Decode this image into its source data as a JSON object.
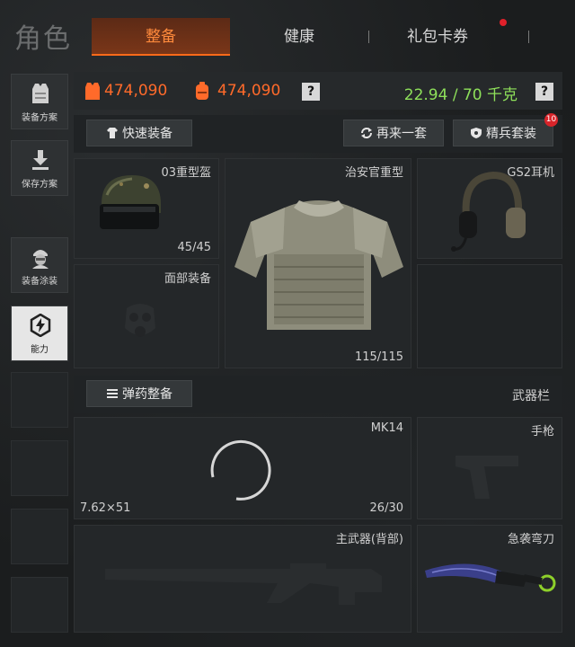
{
  "page_title": "角色",
  "tabs": [
    {
      "label": "整备",
      "active": true
    },
    {
      "label": "健康",
      "active": false
    },
    {
      "label": "礼包卡券",
      "active": false
    }
  ],
  "sidebar": [
    {
      "label": "装备方案",
      "icon": "vest-plan-icon"
    },
    {
      "label": "保存方案",
      "icon": "download-icon"
    },
    {
      "label": "装备涂装",
      "icon": "soldier-icon"
    },
    {
      "label": "能力",
      "icon": "lightning-icon",
      "active": true
    }
  ],
  "resources": {
    "vest_value": "474,090",
    "backpack_value": "474,090",
    "help": "?",
    "weight": "22.94 / 70 千克",
    "weight_help": "?"
  },
  "toolbar": {
    "quick_equip": "快速装备",
    "again": "再来一套",
    "elite_set": "精兵套装",
    "elite_badge": "10"
  },
  "slots": {
    "helmet": {
      "name": "03重型盔",
      "count": "45/45"
    },
    "armor": {
      "name": "治安官重型",
      "count": "115/115"
    },
    "headset": {
      "name": "GS2耳机"
    },
    "face": {
      "name": "面部装备"
    },
    "ammo_button": "弹药整备",
    "weapons_label": "武器栏",
    "primary": {
      "name": "MK14",
      "caliber": "7.62×51",
      "count": "26/30"
    },
    "pistol": {
      "name": "手枪"
    },
    "secondary": {
      "name": "主武器(背部)"
    },
    "melee": {
      "name": "急袭弯刀"
    }
  },
  "colors": {
    "accent_orange": "#ff6a2a",
    "weight_green": "#8ee05a",
    "badge_red": "#d8242a"
  }
}
